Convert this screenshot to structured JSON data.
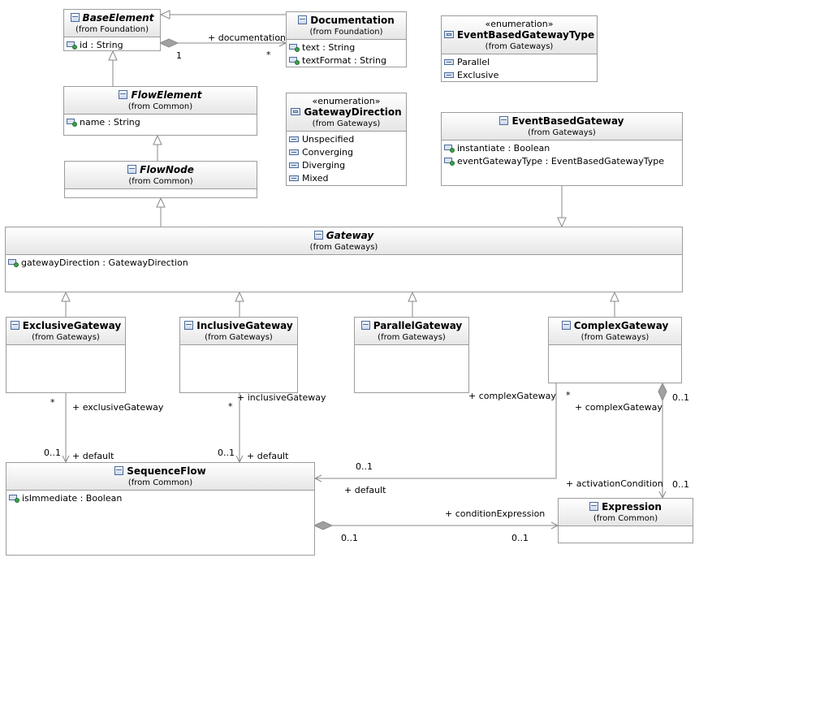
{
  "classes": {
    "base_element": {
      "name": "BaseElement",
      "from": "(from Foundation)",
      "attributes": [
        "id : String"
      ]
    },
    "documentation": {
      "name": "Documentation",
      "from": "(from Foundation)",
      "attributes": [
        "text : String",
        "textFormat : String"
      ]
    },
    "event_based_gateway_type": {
      "stereotype": "«enumeration»",
      "name": "EventBasedGatewayType",
      "from": "(from Gateways)",
      "literals": [
        "Parallel",
        "Exclusive"
      ]
    },
    "flow_element": {
      "name": "FlowElement",
      "from": "(from Common)",
      "attributes": [
        "name : String"
      ]
    },
    "gateway_direction": {
      "stereotype": "«enumeration»",
      "name": "GatewayDirection",
      "from": "(from Gateways)",
      "literals": [
        "Unspecified",
        "Converging",
        "Diverging",
        "Mixed"
      ]
    },
    "event_based_gateway": {
      "name": "EventBasedGateway",
      "from": "(from Gateways)",
      "attributes": [
        "instantiate : Boolean",
        "eventGatewayType : EventBasedGatewayType"
      ]
    },
    "flow_node": {
      "name": "FlowNode",
      "from": "(from Common)"
    },
    "gateway": {
      "name": "Gateway",
      "from": "(from Gateways)",
      "attributes": [
        "gatewayDirection : GatewayDirection"
      ]
    },
    "exclusive_gateway": {
      "name": "ExclusiveGateway",
      "from": "(from Gateways)"
    },
    "inclusive_gateway": {
      "name": "InclusiveGateway",
      "from": "(from Gateways)"
    },
    "parallel_gateway": {
      "name": "ParallelGateway",
      "from": "(from Gateways)"
    },
    "complex_gateway": {
      "name": "ComplexGateway",
      "from": "(from Gateways)"
    },
    "sequence_flow": {
      "name": "SequenceFlow",
      "from": "(from Common)",
      "attributes": [
        "isImmediate : Boolean"
      ]
    },
    "expression": {
      "name": "Expression",
      "from": "(from Common)"
    }
  },
  "labels": {
    "documentation_role": "+ documentation",
    "documentation_mult_source": "1",
    "documentation_mult_target": "*",
    "exclusive_role": "+ exclusiveGateway",
    "exclusive_mult_source": "*",
    "exclusive_default_mult": "0..1",
    "exclusive_default_role": "+ default",
    "inclusive_role": "+ inclusiveGateway",
    "inclusive_mult_source": "*",
    "inclusive_default_mult": "0..1",
    "inclusive_default_role": "+ default",
    "complex_role_left": "+ complexGateway",
    "complex_mult_star": "*",
    "complex_role_right": "+ complexGateway",
    "complex_mult_right": "0..1",
    "complex_default_mult": "0..1",
    "complex_default_role": "+ default",
    "activation_condition_role": "+ activationCondition",
    "activation_condition_mult": "0..1",
    "condition_expression_role": "+ conditionExpression",
    "condition_mult_source": "0..1",
    "condition_mult_target": "0..1"
  }
}
